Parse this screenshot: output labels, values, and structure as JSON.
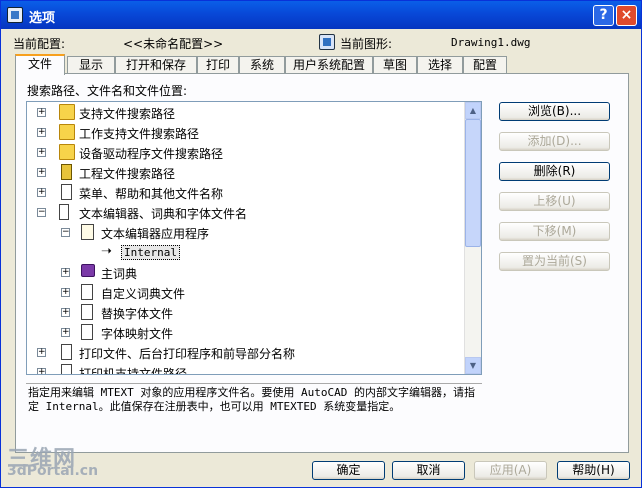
{
  "window": {
    "title": "选项",
    "help_button": "?",
    "close_button": "×"
  },
  "header": {
    "current_profile_label": "当前配置:",
    "current_profile_value": "<<未命名配置>>",
    "current_drawing_label": "当前图形:",
    "current_drawing_value": "Drawing1.dwg"
  },
  "tabs": [
    "文件",
    "显示",
    "打开和保存",
    "打印",
    "系统",
    "用户系统配置",
    "草图",
    "选择",
    "配置"
  ],
  "active_tab": "文件",
  "tree_label": "搜索路径、文件名和文件位置:",
  "tree": [
    {
      "label": "支持文件搜索路径",
      "expander": "+",
      "icon": "folder-icon"
    },
    {
      "label": "工作支持文件搜索路径",
      "expander": "+",
      "icon": "folder-icon"
    },
    {
      "label": "设备驱动程序文件搜索路径",
      "expander": "+",
      "icon": "folder-icon"
    },
    {
      "label": "工程文件搜索路径",
      "expander": "+",
      "icon": "project-icon"
    },
    {
      "label": "菜单、帮助和其他文件名称",
      "expander": "+",
      "icon": "document-icon"
    },
    {
      "label": "文本编辑器、词典和字体文件名",
      "expander": "−",
      "icon": "documents-icon"
    },
    {
      "label": "文本编辑器应用程序",
      "expander": "−",
      "icon": "notepad-icon"
    },
    {
      "label": "Internal",
      "expander": "",
      "icon": "arrow-icon"
    },
    {
      "label": "主词典",
      "expander": "+",
      "icon": "book-icon"
    },
    {
      "label": "自定义词典文件",
      "expander": "+",
      "icon": "dictionary-file-icon"
    },
    {
      "label": "替换字体文件",
      "expander": "+",
      "icon": "font-file-icon"
    },
    {
      "label": "字体映射文件",
      "expander": "+",
      "icon": "font-map-icon"
    },
    {
      "label": "打印文件、后台打印程序和前导部分名称",
      "expander": "+",
      "icon": "document-icon"
    },
    {
      "label": "打印机支持文件路径",
      "expander": "+",
      "icon": "folder-icon"
    }
  ],
  "side_buttons": [
    {
      "label": "浏览(B)...",
      "enabled": true
    },
    {
      "label": "添加(D)...",
      "enabled": false
    },
    {
      "label": "删除(R)",
      "enabled": true
    },
    {
      "label": "上移(U)",
      "enabled": false
    },
    {
      "label": "下移(M)",
      "enabled": false
    },
    {
      "label": "置为当前(S)",
      "enabled": false
    }
  ],
  "description": "指定用来编辑 MTEXT 对象的应用程序文件名。要使用 AutoCAD 的内部文字编辑器，请指定 Internal。此值保存在注册表中，也可以用 MTEXTED 系统变量指定。",
  "bottom_buttons": [
    {
      "label": "确定",
      "enabled": true
    },
    {
      "label": "取消",
      "enabled": true
    },
    {
      "label": "应用(A)",
      "enabled": false
    },
    {
      "label": "帮助(H)",
      "enabled": true
    }
  ],
  "watermark": {
    "line1": "三维网",
    "line2": "3dPortal.cn"
  },
  "colors": {
    "titlebar": "#0848d8",
    "active_tab_accent": "#f7a01e",
    "dialog_bg": "#ece9d8"
  }
}
